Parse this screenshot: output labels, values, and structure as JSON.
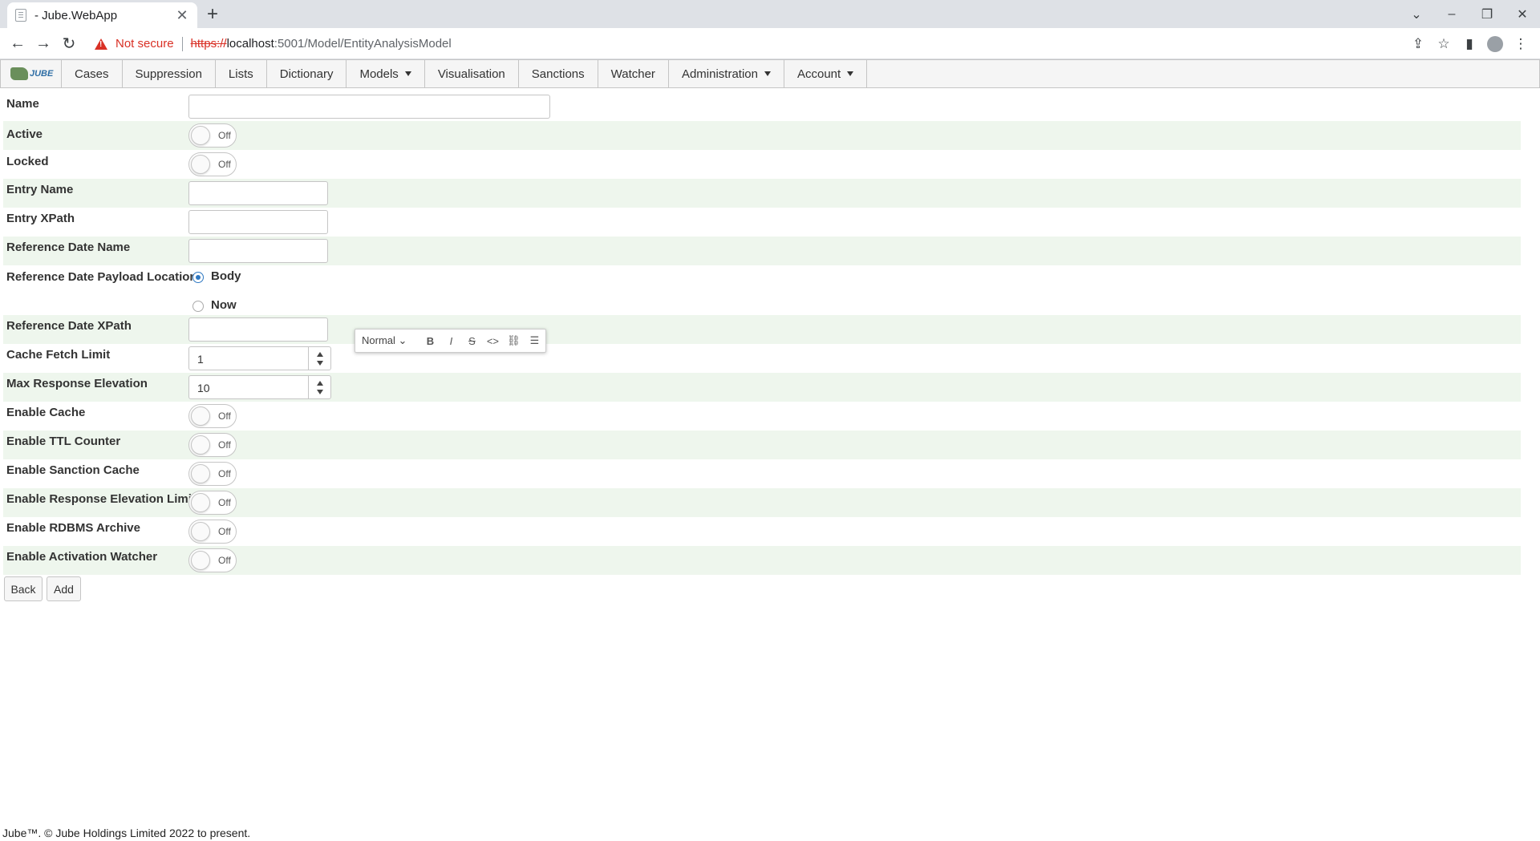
{
  "browser": {
    "tab_title": "- Jube.WebApp",
    "not_secure": "Not secure",
    "url_scheme": "https://",
    "url_host": "localhost",
    "url_path": ":5001/Model/EntityAnalysisModel"
  },
  "nav": {
    "logo_text": "JUBE",
    "items": [
      "Cases",
      "Suppression",
      "Lists",
      "Dictionary",
      "Models",
      "Visualisation",
      "Sanctions",
      "Watcher",
      "Administration",
      "Account"
    ]
  },
  "form": {
    "name_label": "Name",
    "active_label": "Active",
    "locked_label": "Locked",
    "entry_name_label": "Entry Name",
    "entry_xpath_label": "Entry XPath",
    "ref_date_name_label": "Reference Date Name",
    "ref_date_payload_label": "Reference Date Payload Location",
    "radio_body": "Body",
    "radio_now": "Now",
    "ref_date_xpath_label": "Reference Date XPath",
    "cache_fetch_limit_label": "Cache Fetch Limit",
    "cache_fetch_limit_value": "1",
    "max_response_elevation_label": "Max Response Elevation",
    "max_response_elevation_value": "10",
    "enable_cache_label": "Enable Cache",
    "enable_ttl_label": "Enable TTL Counter",
    "enable_sanction_label": "Enable Sanction Cache",
    "enable_rel_label": "Enable Response Elevation Limit",
    "enable_rdbms_label": "Enable RDBMS Archive",
    "enable_watcher_label": "Enable Activation Watcher",
    "toggle_off": "Off"
  },
  "rte": {
    "format": "Normal",
    "bold": "B",
    "italic": "I",
    "strike": "S",
    "code": "<>"
  },
  "buttons": {
    "back": "Back",
    "add": "Add"
  },
  "footer": "Jube™. © Jube Holdings Limited 2022 to present."
}
